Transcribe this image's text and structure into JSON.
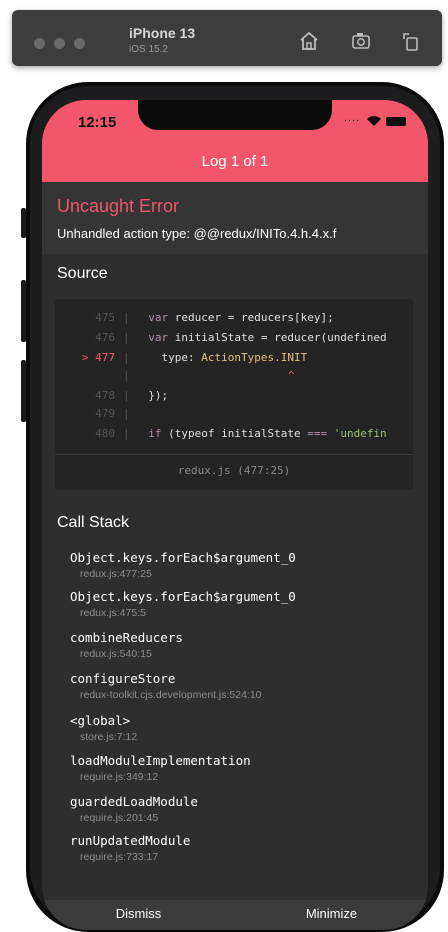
{
  "simulator": {
    "device": "iPhone 13",
    "os": "iOS 15.2",
    "icons": [
      "home-icon",
      "screenshot-icon",
      "rotate-icon"
    ]
  },
  "status_bar": {
    "time": "12:15",
    "dots": "....",
    "icons": [
      "wifi-icon",
      "battery-icon"
    ]
  },
  "header": {
    "title": "Log 1 of 1"
  },
  "error": {
    "title": "Uncaught Error",
    "message": "Unhandled action type: @@redux/INITo.4.h.4.x.f"
  },
  "source": {
    "label": "Source",
    "lines": [
      {
        "marker": "",
        "num": "475",
        "sep": "|",
        "indent": "  ",
        "kw": "var",
        "rest": " reducer = reducers[key];"
      },
      {
        "marker": "",
        "num": "476",
        "sep": "|",
        "indent": "  ",
        "kw": "var",
        "rest": " initialState = reducer(undefined"
      },
      {
        "marker": ">",
        "num": "477",
        "sep": "|",
        "indent": "    ",
        "kw": "",
        "rest": "type: ",
        "hl": "ActionTypes.INIT"
      },
      {
        "marker": "",
        "num": "",
        "sep": "|",
        "indent": "",
        "kw": "",
        "rest": "",
        "caret": "^"
      },
      {
        "marker": "",
        "num": "478",
        "sep": "|",
        "indent": "  ",
        "kw": "",
        "rest": "});"
      },
      {
        "marker": "",
        "num": "479",
        "sep": "|",
        "indent": "",
        "kw": "",
        "rest": ""
      },
      {
        "marker": "",
        "num": "480",
        "sep": "|",
        "indent": "  ",
        "kw": "if",
        "rest": " (typeof initialState ",
        "op": "===",
        "str": " 'undefin"
      }
    ],
    "file_location": "redux.js (477:25)"
  },
  "call_stack": {
    "label": "Call Stack",
    "frames": [
      {
        "fn": "Object.keys.forEach$argument_0",
        "loc": "redux.js:477:25"
      },
      {
        "fn": "Object.keys.forEach$argument_0",
        "loc": "redux.js:475:5"
      },
      {
        "fn": "combineReducers",
        "loc": "redux.js:540:15"
      },
      {
        "fn": "configureStore",
        "loc": "redux-toolkit.cjs.development.js:524:10"
      },
      {
        "fn": "<global>",
        "loc": "store.js:7:12"
      },
      {
        "fn": "loadModuleImplementation",
        "loc": "require.js:349:12"
      },
      {
        "fn": "guardedLoadModule",
        "loc": "require.js:201:45"
      },
      {
        "fn": "runUpdatedModule",
        "loc": "require.js:733:17"
      }
    ]
  },
  "footer": {
    "dismiss": "Dismiss",
    "minimize": "Minimize"
  },
  "colors": {
    "accent": "#f2566a",
    "background": "#2e2e2e",
    "code_bg": "#242424"
  }
}
